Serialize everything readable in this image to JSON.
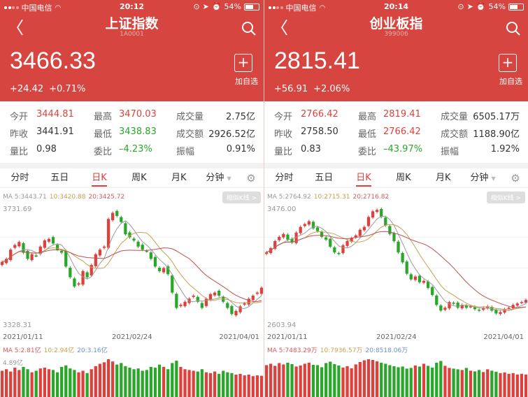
{
  "colors": {
    "accent": "#d6453f",
    "up": "#e0403c",
    "down": "#2aa62a"
  },
  "panels": [
    {
      "status": {
        "carrier": "中国电信",
        "time": "20:12",
        "battery": "54%"
      },
      "title": "上证指数",
      "code": "1A0001",
      "price": "3466.33",
      "change": "+24.42",
      "change_pct": "+0.71%",
      "add_label": "加自选",
      "stats": {
        "open_l": "今开",
        "open": "3444.81",
        "high_l": "最高",
        "high": "3470.03",
        "vol_l": "成交量",
        "vol": "2.75亿",
        "prev_l": "昨收",
        "prev": "3441.91",
        "low_l": "最低",
        "low": "3438.83",
        "amt_l": "成交额",
        "amt": "2926.52亿",
        "ratio_l": "量比",
        "ratio": "0.98",
        "wb_l": "委比",
        "wb": "–4.23%",
        "amp_l": "振幅",
        "amp": "0.91%"
      },
      "tabs": [
        "分时",
        "五日",
        "日K",
        "周K",
        "月K",
        "分钟"
      ],
      "selected_tab": 2,
      "ma": {
        "ma5": "MA 5:3443.71",
        "ma10": "10:3420.88",
        "ma20": "20:3425.72"
      },
      "similar_k": "相似K线 >",
      "ymax": "3731.69",
      "ymin": "3328.31",
      "dates": [
        "2021/01/11",
        "2021/02/24",
        "2021/04/01"
      ],
      "vol_ma": {
        "ma5": "MA 5:2.81亿",
        "ma10": "10:2.94亿",
        "ma20": "20:3.16亿"
      },
      "vol_max": "4.89亿",
      "chart_data": {
        "type": "candlestick",
        "ylim": [
          3328.31,
          3731.69
        ],
        "closes": [
          3550,
          3560,
          3590,
          3605,
          3615,
          3580,
          3560,
          3575,
          3570,
          3600,
          3620,
          3625,
          3610,
          3590,
          3580,
          3535,
          3500,
          3470,
          3480,
          3520,
          3500,
          3540,
          3575,
          3590,
          3600,
          3690,
          3710,
          3700,
          3680,
          3640,
          3630,
          3620,
          3600,
          3590,
          3585,
          3560,
          3535,
          3520,
          3530,
          3510,
          3450,
          3400,
          3410,
          3420,
          3430,
          3440,
          3420,
          3400,
          3430,
          3445,
          3450,
          3440,
          3420,
          3400,
          3380,
          3390,
          3405,
          3415,
          3430,
          3440,
          3450,
          3466
        ],
        "volumes": [
          3.4,
          3.6,
          3.3,
          3.8,
          3.5,
          3.9,
          3.6,
          3.2,
          3.4,
          3.7,
          3.8,
          3.6,
          3.5,
          3.2,
          3.9,
          4.1,
          3.7,
          3.5,
          3.2,
          3.4,
          3.1,
          3.6,
          4.0,
          4.3,
          4.5,
          4.89,
          4.6,
          4.2,
          4.4,
          4.0,
          3.8,
          3.6,
          3.7,
          3.4,
          3.5,
          3.9,
          3.8,
          4.2,
          3.9,
          3.6,
          4.4,
          4.7,
          3.9,
          3.6,
          3.5,
          3.4,
          3.3,
          3.6,
          3.2,
          3.1,
          3.3,
          3.0,
          3.4,
          3.2,
          3.1,
          2.9,
          3.0,
          2.8,
          2.9,
          2.7,
          2.8,
          2.75
        ]
      }
    },
    {
      "status": {
        "carrier": "中国电信",
        "time": "20:14",
        "battery": "54%"
      },
      "title": "创业板指",
      "code": "399006",
      "price": "2815.41",
      "change": "+56.91",
      "change_pct": "+2.06%",
      "add_label": "加自选",
      "stats": {
        "open_l": "今开",
        "open": "2766.42",
        "high_l": "最高",
        "high": "2819.41",
        "vol_l": "成交量",
        "vol": "6505.17万",
        "prev_l": "昨收",
        "prev": "2758.50",
        "low_l": "最低",
        "low": "2766.42",
        "amt_l": "成交额",
        "amt": "1188.90亿",
        "ratio_l": "量比",
        "ratio": "0.83",
        "wb_l": "委比",
        "wb": "–43.97%",
        "amp_l": "振幅",
        "amp": "1.92%"
      },
      "tabs": [
        "分时",
        "五日",
        "日K",
        "周K",
        "月K",
        "分钟"
      ],
      "selected_tab": 2,
      "ma": {
        "ma5": "MA 5:2764.92",
        "ma10": "10:2715.31",
        "ma20": "20:2716.82"
      },
      "similar_k": "相似K线 >",
      "ymax": "3476.00",
      "ymin": "2603.94",
      "dates": [
        "2021/01/11",
        "2021/02/24",
        "2021/04/01"
      ],
      "vol_ma": {
        "ma5": "MA 5:7483.29万",
        "ma10": "10:7936.57万",
        "ma20": "20:8518.06万"
      },
      "vol_max": "",
      "chart_data": {
        "type": "candlestick",
        "ylim": [
          2603.94,
          3476.0
        ],
        "closes": [
          3150,
          3180,
          3230,
          3260,
          3280,
          3240,
          3220,
          3290,
          3330,
          3350,
          3370,
          3320,
          3300,
          3260,
          3240,
          3190,
          3150,
          3140,
          3200,
          3230,
          3250,
          3270,
          3310,
          3330,
          3400,
          3440,
          3450,
          3400,
          3340,
          3280,
          3230,
          3150,
          3080,
          3000,
          2960,
          2980,
          2940,
          2950,
          2900,
          2850,
          2780,
          2740,
          2760,
          2800,
          2790,
          2760,
          2780,
          2760,
          2770,
          2750,
          2740,
          2760,
          2770,
          2740,
          2720,
          2730,
          2750,
          2760,
          2780,
          2790,
          2800,
          2815
        ],
        "volumes": [
          9.2,
          9.6,
          9.0,
          9.8,
          9.4,
          9.9,
          9.5,
          8.8,
          9.1,
          9.6,
          9.9,
          9.3,
          9.2,
          8.6,
          9.8,
          10.2,
          9.5,
          9.1,
          8.5,
          8.9,
          8.3,
          9.4,
          10.1,
          10.6,
          10.9,
          10.7,
          10.3,
          9.9,
          9.6,
          9.2,
          8.9,
          8.6,
          8.8,
          8.2,
          8.4,
          9.1,
          8.8,
          9.6,
          9.0,
          8.5,
          9.9,
          10.4,
          9.0,
          8.4,
          8.2,
          8.0,
          7.8,
          8.4,
          7.6,
          7.4,
          7.8,
          7.2,
          8.0,
          7.6,
          7.3,
          6.9,
          7.1,
          6.7,
          6.9,
          6.5,
          6.7,
          6.5
        ]
      }
    }
  ]
}
